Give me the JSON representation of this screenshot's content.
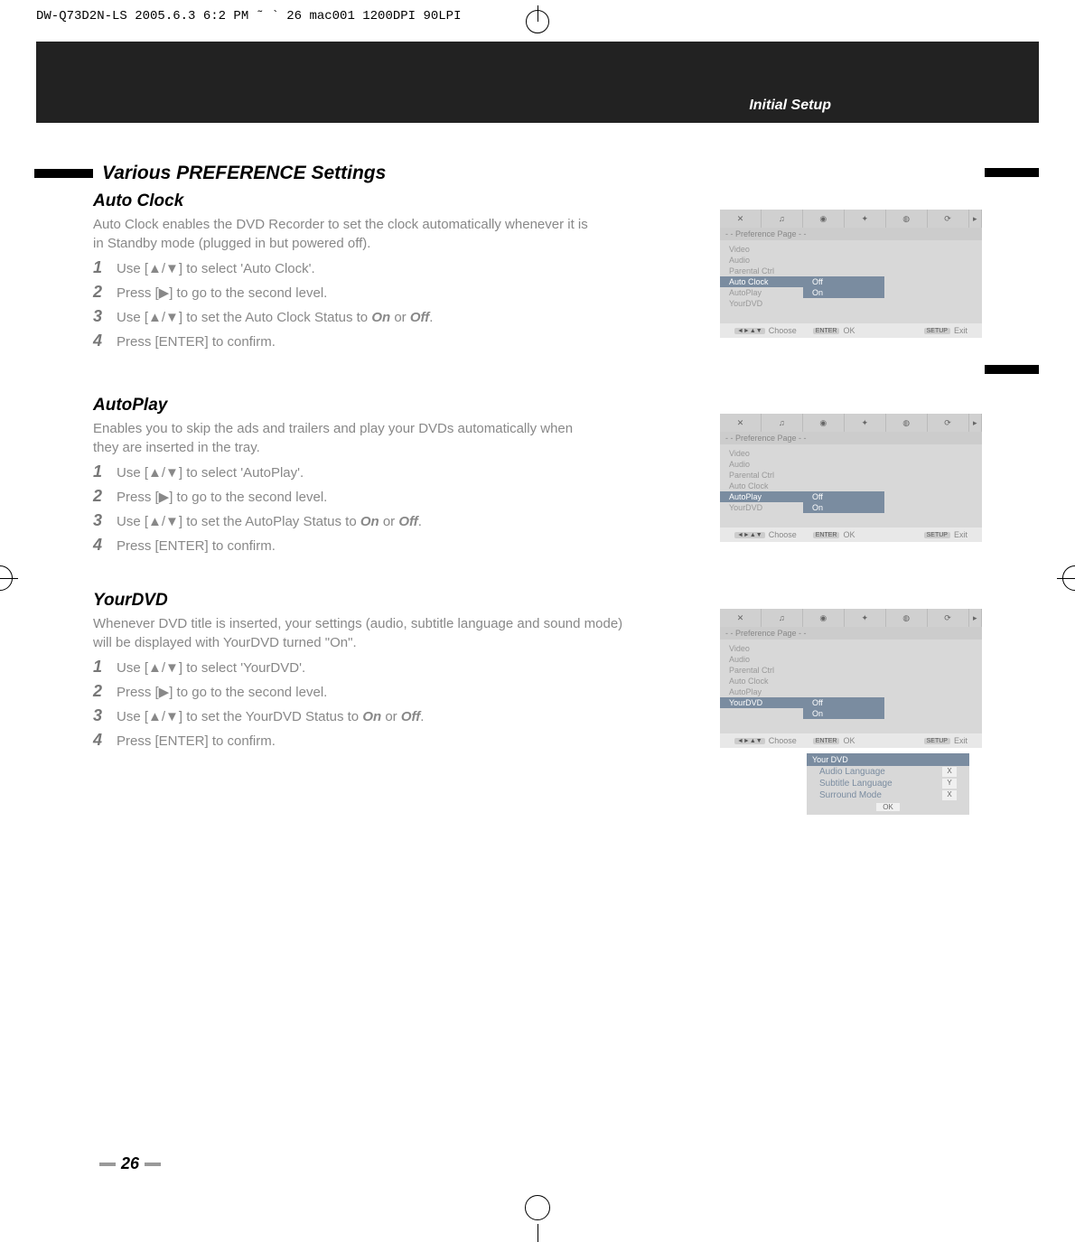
{
  "header_code": "DW-Q73D2N-LS  2005.6.3 6:2 PM  ˜    ` 26   mac001   1200DPI 90LPI",
  "breadcrumb": "Initial Setup",
  "section_title": "Various PREFERENCE Settings",
  "page_number": "26",
  "subsections": {
    "auto_clock": {
      "title": "Auto Clock",
      "desc": "Auto Clock enables the DVD Recorder to set the clock automatically whenever it is in Standby mode (plugged in but powered off).",
      "steps": [
        "Use [▲/▼] to select 'Auto Clock'.",
        "Press [▶] to go to the second level.",
        "Use [▲/▼] to set the Auto Clock Status to <b>On</b> or <b>Off</b>.",
        "Press [ENTER] to confirm."
      ]
    },
    "autoplay": {
      "title": "AutoPlay",
      "desc": "Enables you to skip the ads and trailers and play your DVDs automatically when they are inserted in the tray.",
      "steps": [
        "Use [▲/▼] to select 'AutoPlay'.",
        "Press [▶] to go to the second level.",
        "Use [▲/▼] to set the AutoPlay Status to <b>On</b> or <b>Off</b>.",
        "Press [ENTER] to confirm."
      ]
    },
    "yourdvd": {
      "title": "YourDVD",
      "desc": "Whenever DVD title is inserted, your settings (audio, subtitle language and sound mode) will be displayed with YourDVD turned \"On\".",
      "steps": [
        "Use [▲/▼] to select 'YourDVD'.",
        "Press [▶] to go to the second level.",
        "Use [▲/▼] to set the YourDVD Status to <b>On</b> or <b>Off</b>.",
        "Press [ENTER] to confirm."
      ]
    }
  },
  "menu": {
    "subtitle": "- - Preference Page - -",
    "items": [
      "Video",
      "Audio",
      "Parental Ctrl",
      "Auto Clock",
      "AutoPlay",
      "YourDVD"
    ],
    "options": [
      "Off",
      "On"
    ],
    "footer": {
      "choose": "Choose",
      "ok": "OK",
      "exit": "Exit",
      "arrows": "◄►▲▼",
      "enter_key": "ENTER",
      "setup_key": "SETUP"
    }
  },
  "your_dvd_popup": {
    "header": "Your DVD",
    "rows": [
      {
        "label": "Audio Language",
        "val": "X"
      },
      {
        "label": "Subtitle Language",
        "val": "Y"
      },
      {
        "label": "Surround Mode",
        "val": "X"
      }
    ],
    "ok": "OK"
  }
}
